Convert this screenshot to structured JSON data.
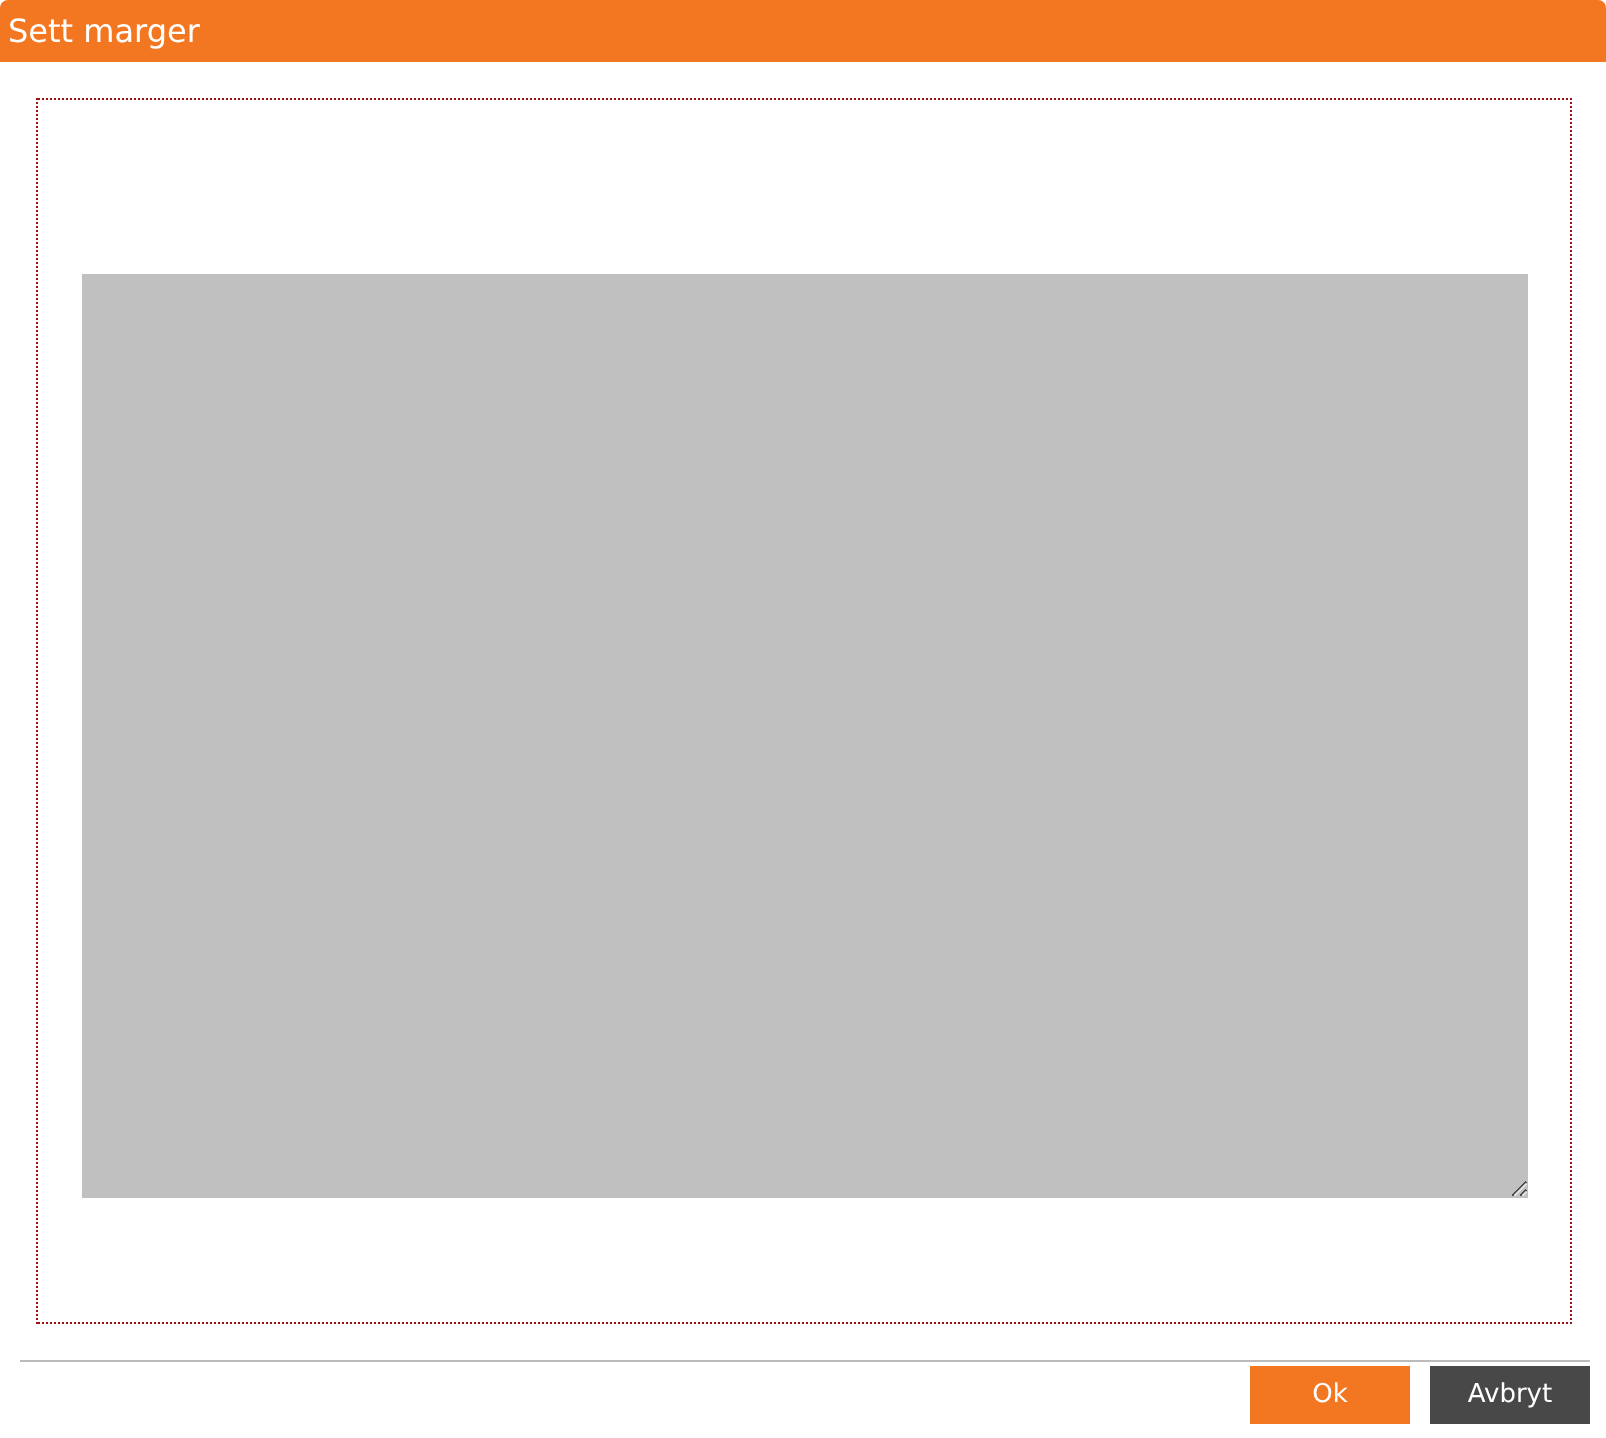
{
  "window": {
    "title": "Sett marger"
  },
  "buttons": [
    {
      "label": "Ok",
      "kind": "primary"
    },
    {
      "label": "Avbryt",
      "kind": "secondary"
    }
  ]
}
